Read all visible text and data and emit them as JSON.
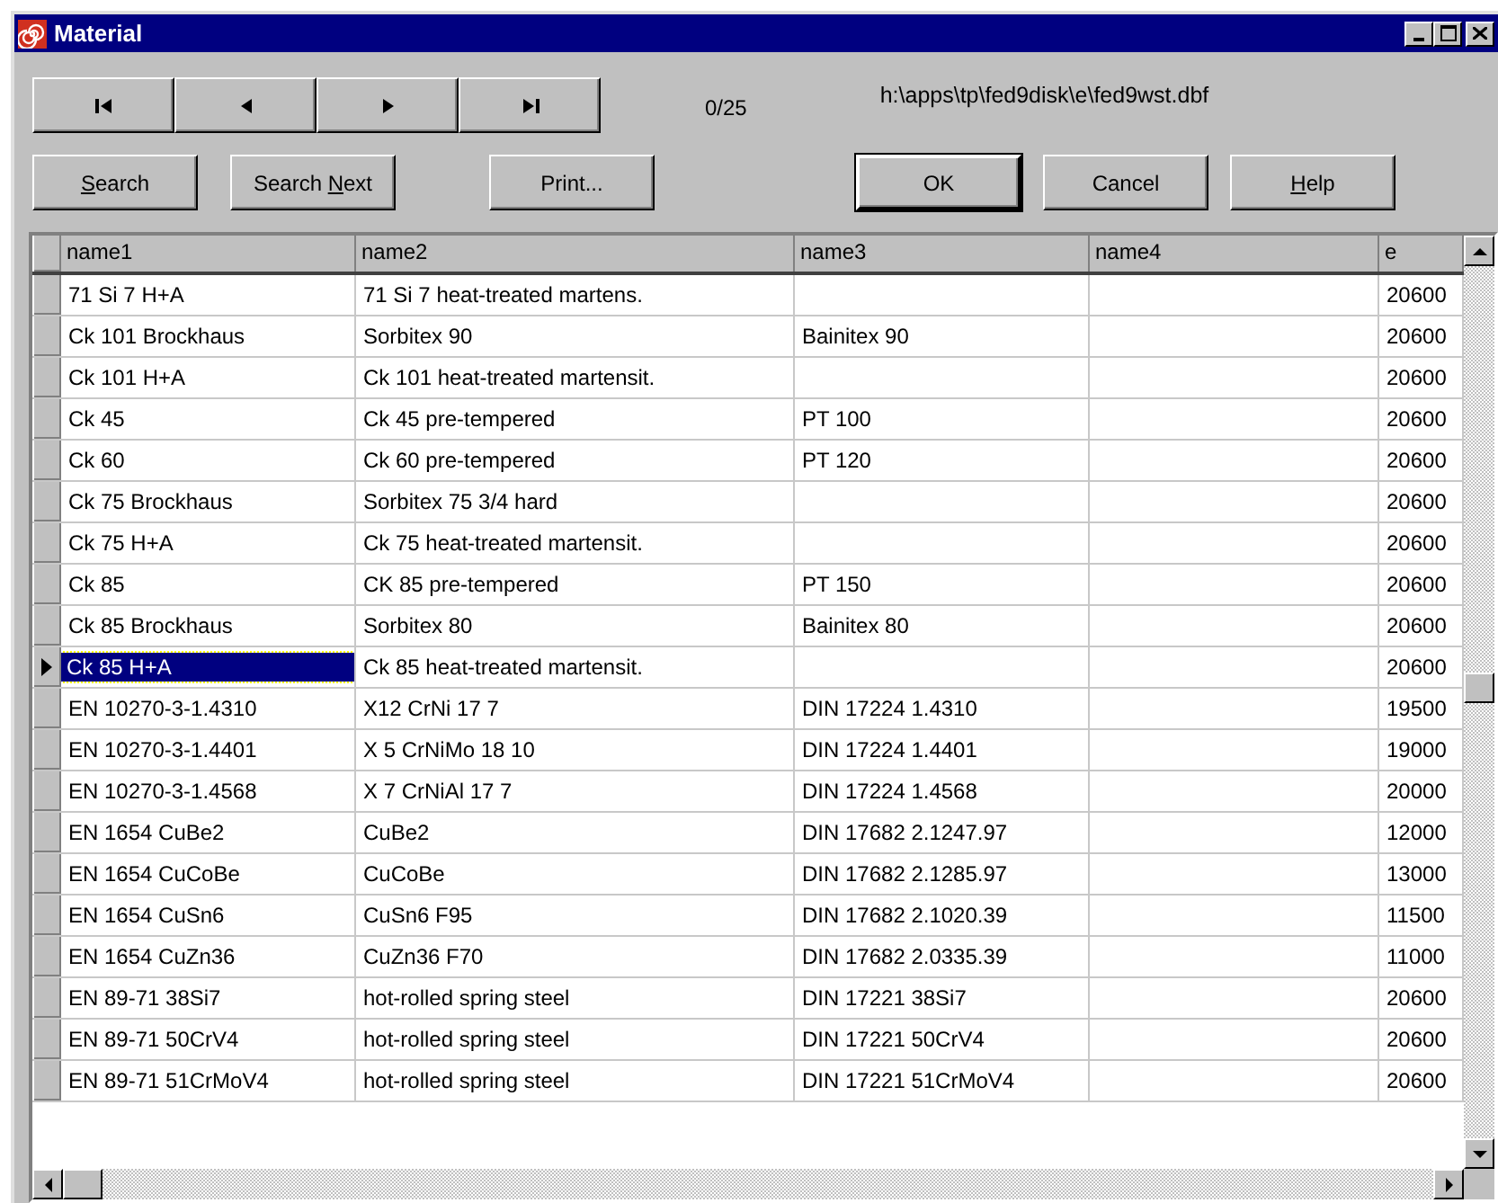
{
  "window": {
    "title": "Material"
  },
  "navigator": {
    "buttons": [
      {
        "kind": "first"
      },
      {
        "kind": "prev"
      },
      {
        "kind": "next"
      },
      {
        "kind": "last"
      }
    ],
    "position": "0/25",
    "path": "h:\\apps\\tp\\fed9disk\\e\\fed9wst.dbf"
  },
  "left_buttons": [
    {
      "parts": [
        {
          "text": "S",
          "underline": true
        },
        {
          "text": "earch",
          "underline": false
        }
      ],
      "default": false
    },
    {
      "parts": [
        {
          "text": "Search ",
          "underline": false
        },
        {
          "text": "N",
          "underline": true
        },
        {
          "text": "ext",
          "underline": false
        }
      ],
      "default": false
    },
    {
      "parts": [
        {
          "text": "Print...",
          "underline": false
        }
      ],
      "default": false
    }
  ],
  "right_buttons": [
    {
      "parts": [
        {
          "text": "OK",
          "underline": false
        }
      ],
      "default": true
    },
    {
      "parts": [
        {
          "text": "Cancel",
          "underline": false
        }
      ],
      "default": false
    },
    {
      "parts": [
        {
          "text": "H",
          "underline": true
        },
        {
          "text": "elp",
          "underline": false
        }
      ],
      "default": false
    }
  ],
  "table": {
    "columns": [
      "name1",
      "name2",
      "name3",
      "name4",
      "e"
    ],
    "rows": [
      {
        "selected": false,
        "cells": [
          "71 Si 7 H+A",
          "71 Si 7 heat-treated martens.",
          "",
          "",
          "20600"
        ]
      },
      {
        "selected": false,
        "cells": [
          "Ck 101 Brockhaus",
          "Sorbitex 90",
          "Bainitex 90",
          "",
          "20600"
        ]
      },
      {
        "selected": false,
        "cells": [
          "Ck 101 H+A",
          "Ck 101 heat-treated martensit.",
          "",
          "",
          "20600"
        ]
      },
      {
        "selected": false,
        "cells": [
          "Ck 45",
          "Ck 45 pre-tempered",
          "PT 100",
          "",
          "20600"
        ]
      },
      {
        "selected": false,
        "cells": [
          "Ck 60",
          "Ck 60 pre-tempered",
          "PT 120",
          "",
          "20600"
        ]
      },
      {
        "selected": false,
        "cells": [
          "Ck 75 Brockhaus",
          "Sorbitex 75  3/4 hard",
          "",
          "",
          "20600"
        ]
      },
      {
        "selected": false,
        "cells": [
          "Ck 75 H+A",
          "Ck 75 heat-treated martensit.",
          "",
          "",
          "20600"
        ]
      },
      {
        "selected": false,
        "cells": [
          "Ck 85",
          "CK 85 pre-tempered",
          "PT 150",
          "",
          "20600"
        ]
      },
      {
        "selected": false,
        "cells": [
          "Ck 85 Brockhaus",
          "Sorbitex 80",
          "Bainitex 80",
          "",
          "20600"
        ]
      },
      {
        "selected": true,
        "cells": [
          "Ck 85 H+A",
          "Ck 85 heat-treated martensit.",
          "",
          "",
          "20600"
        ]
      },
      {
        "selected": false,
        "cells": [
          "EN 10270-3-1.4310",
          "X12 CrNi 17 7",
          "DIN 17224 1.4310",
          "",
          "19500"
        ]
      },
      {
        "selected": false,
        "cells": [
          "EN 10270-3-1.4401",
          "X 5 CrNiMo 18 10",
          "DIN 17224 1.4401",
          "",
          "19000"
        ]
      },
      {
        "selected": false,
        "cells": [
          "EN 10270-3-1.4568",
          "X 7 CrNiAl 17 7",
          "DIN 17224 1.4568",
          "",
          "20000"
        ]
      },
      {
        "selected": false,
        "cells": [
          "EN 1654 CuBe2",
          "CuBe2",
          "DIN 17682 2.1247.97",
          "",
          "12000"
        ]
      },
      {
        "selected": false,
        "cells": [
          "EN 1654 CuCoBe",
          "CuCoBe",
          "DIN 17682 2.1285.97",
          "",
          "13000"
        ]
      },
      {
        "selected": false,
        "cells": [
          "EN 1654 CuSn6",
          "CuSn6 F95",
          "DIN 17682 2.1020.39",
          "",
          "11500"
        ]
      },
      {
        "selected": false,
        "cells": [
          "EN 1654 CuZn36",
          "CuZn36 F70",
          "DIN 17682 2.0335.39",
          "",
          "11000"
        ]
      },
      {
        "selected": false,
        "cells": [
          "EN 89-71 38Si7",
          "hot-rolled spring steel",
          "DIN 17221 38Si7",
          "",
          "20600"
        ]
      },
      {
        "selected": false,
        "cells": [
          "EN 89-71 50CrV4",
          "hot-rolled spring steel",
          "DIN 17221 50CrV4",
          "",
          "20600"
        ]
      },
      {
        "selected": false,
        "cells": [
          "EN 89-71 51CrMoV4",
          "hot-rolled spring steel",
          "DIN 17221 51CrMoV4",
          "",
          "20600"
        ]
      }
    ]
  }
}
